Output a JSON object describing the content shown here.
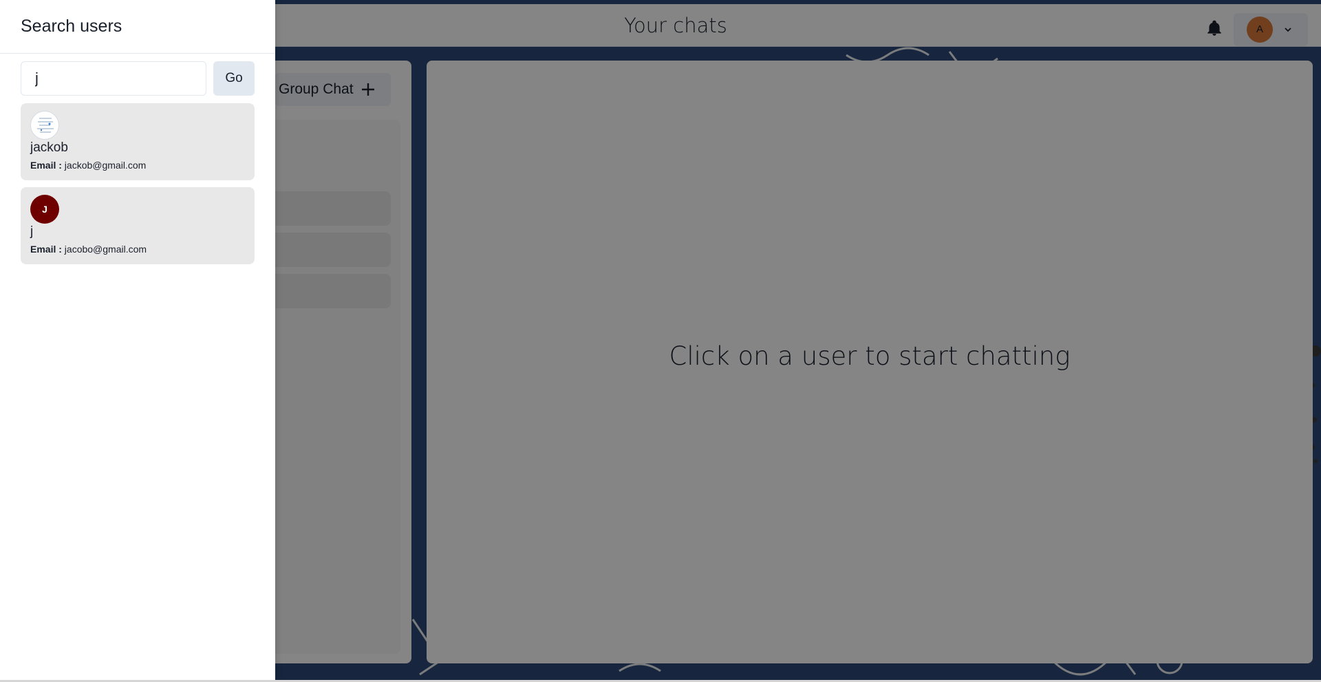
{
  "header": {
    "title": "Your chats",
    "profile_initial": "A"
  },
  "my_chats": {
    "group_chat_label": "Group Chat"
  },
  "chatbox": {
    "placeholder_text": "Click on a user to start chatting"
  },
  "drawer": {
    "title": "Search users",
    "search_value": "j",
    "go_label": "Go",
    "results": [
      {
        "avatar": "image",
        "name": "jackob",
        "email_label": "Email :",
        "email": "jackob@gmail.com"
      },
      {
        "avatar": "J",
        "name": "j",
        "email_label": "Email :",
        "email": "jacobo@gmail.com"
      }
    ]
  },
  "colors": {
    "overlay": "#000000",
    "drawer_bg": "#ffffff",
    "result_card_bg": "#e8e8e8",
    "avatar_initial_bg": "#6e0000",
    "profile_avatar_bg": "#d97a3a",
    "background_doodle": "#2d4a78"
  },
  "icons": {
    "bell": "bell-icon",
    "chevron": "chevron-down-icon",
    "plus": "plus-icon"
  }
}
